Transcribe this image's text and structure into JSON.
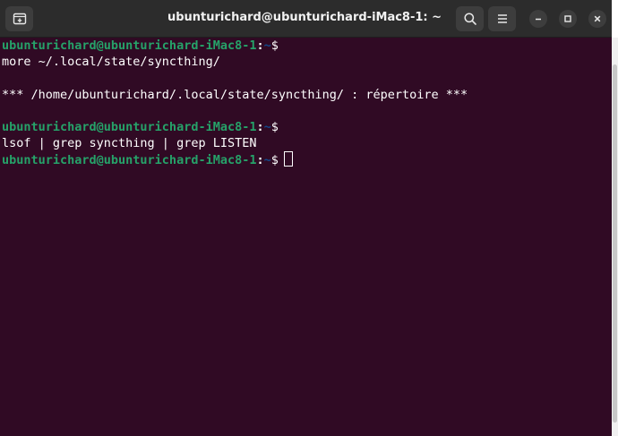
{
  "window": {
    "title": "ubunturichard@ubunturichard-iMac8-1: ~"
  },
  "toolbar": {
    "new_tab_icon": "new-tab-icon",
    "search_icon": "search-icon",
    "menu_icon": "hamburger-menu-icon",
    "minimize_icon": "minimize-icon",
    "maximize_icon": "maximize-icon",
    "close_icon": "close-icon"
  },
  "terminal": {
    "prompt": {
      "user_host": "ubunturichard@ubunturichard-iMac8-1",
      "sep": ":",
      "path": "~",
      "sign": "$"
    },
    "commands": [
      "more ~/.local/state/syncthing/",
      "lsof | grep syncthing | grep LISTEN"
    ],
    "output": [
      "*** /home/ubunturichard/.local/state/syncthing/ : répertoire ***"
    ]
  },
  "colors": {
    "background": "#300a24",
    "prompt_user": "#26a269",
    "prompt_path": "#12488b",
    "titlebar": "#2c2c2c"
  }
}
